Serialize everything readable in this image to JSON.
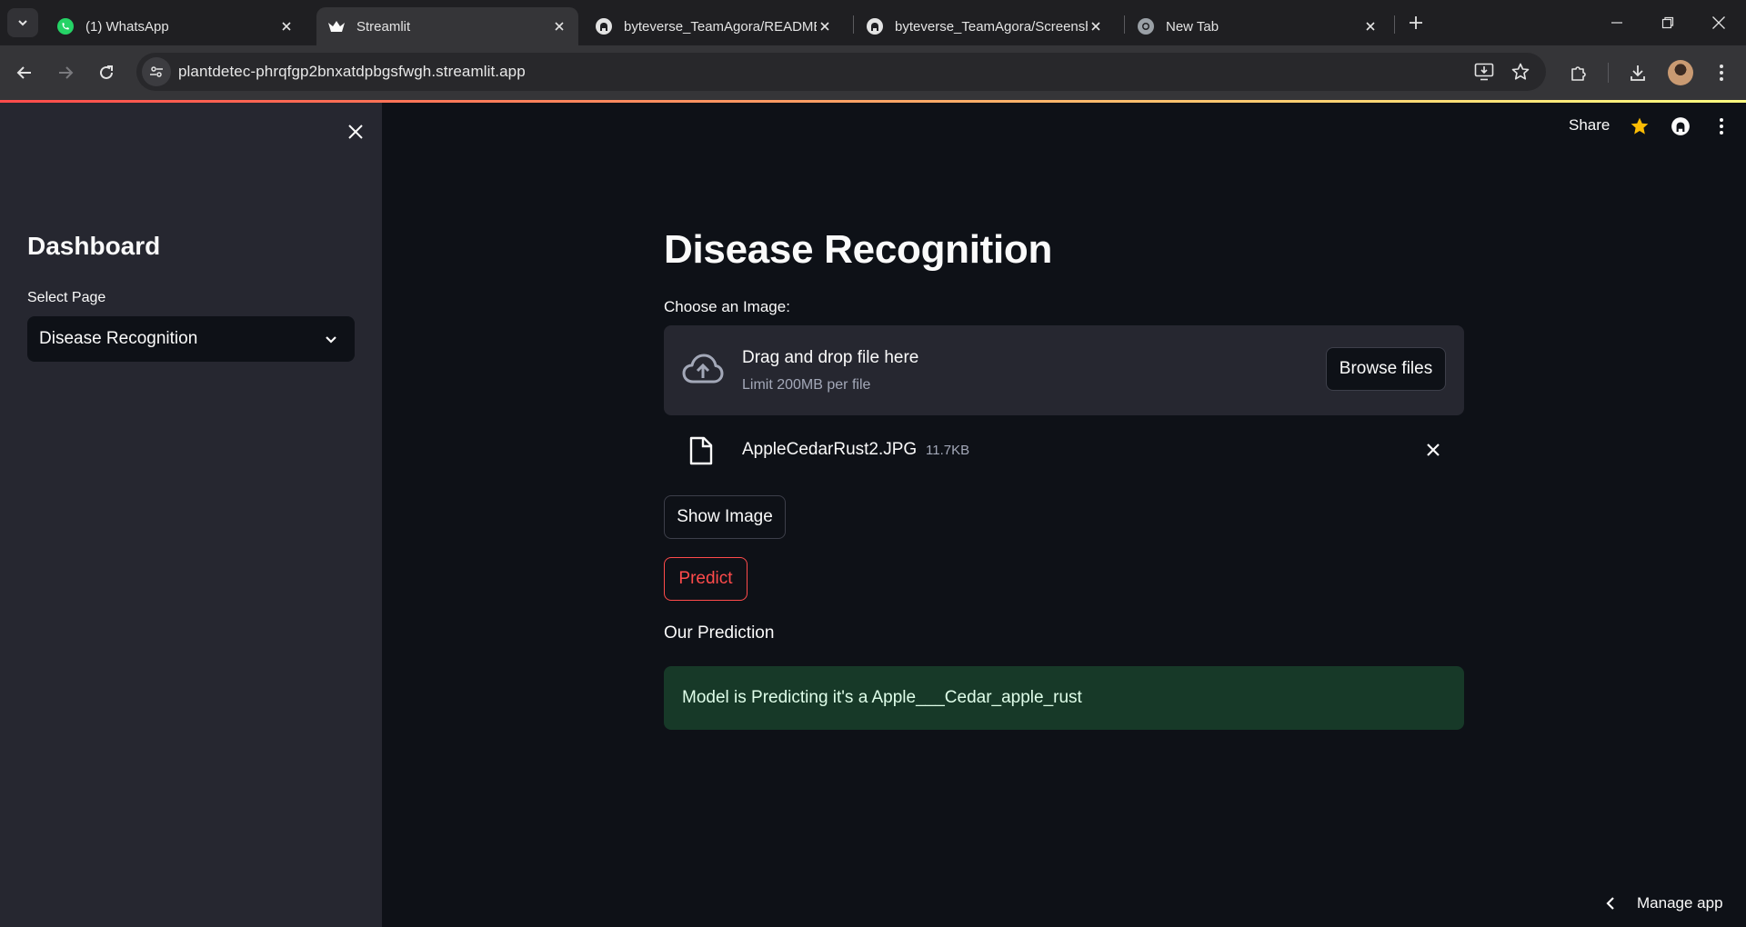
{
  "browser": {
    "tabs": [
      {
        "title": "(1) WhatsApp",
        "icon": "whatsapp-icon",
        "active": false
      },
      {
        "title": "Streamlit",
        "icon": "streamlit-icon",
        "active": true
      },
      {
        "title": "byteverse_TeamAgora/README",
        "icon": "github-icon",
        "active": false
      },
      {
        "title": "byteverse_TeamAgora/Screensh",
        "icon": "github-icon",
        "active": false
      },
      {
        "title": "New Tab",
        "icon": "chrome-icon",
        "active": false
      }
    ],
    "url": "plantdetec-phrqfgp2bnxatdpbgsfwgh.streamlit.app"
  },
  "header": {
    "share_label": "Share"
  },
  "sidebar": {
    "heading": "Dashboard",
    "select_label": "Select Page",
    "select_value": "Disease Recognition"
  },
  "main": {
    "title": "Disease Recognition",
    "uploader": {
      "label": "Choose an Image:",
      "drop_text": "Drag and drop file here",
      "limit_text": "Limit 200MB per file",
      "browse_label": "Browse files",
      "file_name": "AppleCedarRust2.JPG",
      "file_size": "11.7KB"
    },
    "show_image_label": "Show Image",
    "predict_label": "Predict",
    "prediction_heading": "Our Prediction",
    "prediction_text": "Model is Predicting it's a Apple___Cedar_apple_rust"
  },
  "footer": {
    "manage_label": "Manage app"
  },
  "colors": {
    "accent": "#ff4b4b",
    "success_bg": "#173928",
    "success_text": "#dffde9",
    "sidebar_bg": "#262730",
    "main_bg": "#0e1117"
  }
}
